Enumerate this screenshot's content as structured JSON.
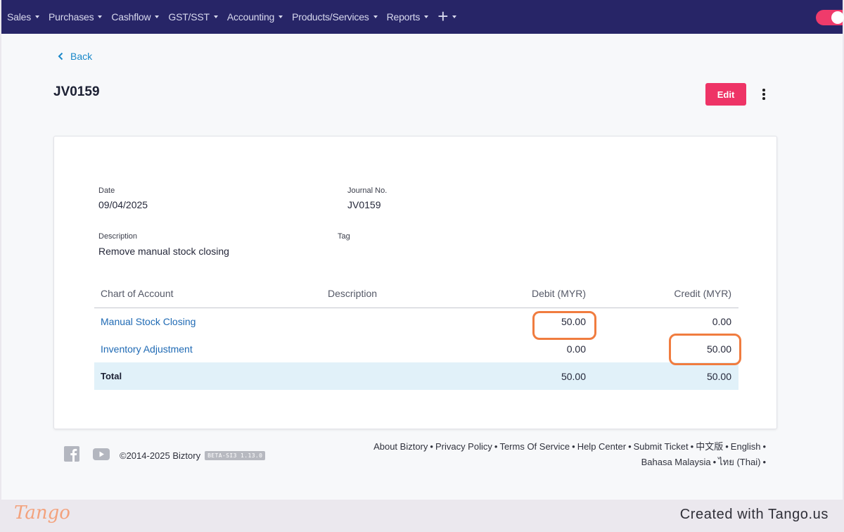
{
  "nav": {
    "items": [
      "Sales",
      "Purchases",
      "Cashflow",
      "GST/SST",
      "Accounting",
      "Products/Services",
      "Reports"
    ],
    "plus": "+"
  },
  "back_label": "Back",
  "page_title": "JV0159",
  "edit_label": "Edit",
  "details": {
    "date_label": "Date",
    "date_value": "09/04/2025",
    "journal_label": "Journal No.",
    "journal_value": "JV0159",
    "description_label": "Description",
    "description_value": "Remove manual stock closing",
    "tag_label": "Tag"
  },
  "table": {
    "headers": {
      "account": "Chart of Account",
      "description": "Description",
      "debit": "Debit (MYR)",
      "credit": "Credit (MYR)"
    },
    "rows": [
      {
        "account": "Manual Stock Closing",
        "debit": "50.00",
        "credit": "0.00"
      },
      {
        "account": "Inventory Adjustment",
        "debit": "0.00",
        "credit": "50.00"
      }
    ],
    "total": {
      "label": "Total",
      "debit": "50.00",
      "credit": "50.00"
    }
  },
  "footer": {
    "copyright": "©2014-2025 Biztory",
    "version": "BETA-SI3 1.13.0",
    "links_line1": [
      "About Biztory",
      "Privacy Policy",
      "Terms Of Service",
      "Help Center",
      "Submit Ticket",
      "中文版",
      "English"
    ],
    "links_line2": [
      "Bahasa Malaysia",
      "ไทย (Thai)"
    ],
    "separator": "•"
  },
  "tango": {
    "logo": "Tango",
    "credit": "Created with Tango.us"
  },
  "colors": {
    "nav_bg": "#272567",
    "edit_button": "#ee3466",
    "link": "#1f6ab4",
    "highlight": "#f07c3f",
    "total_row": "#e1f1f9"
  }
}
